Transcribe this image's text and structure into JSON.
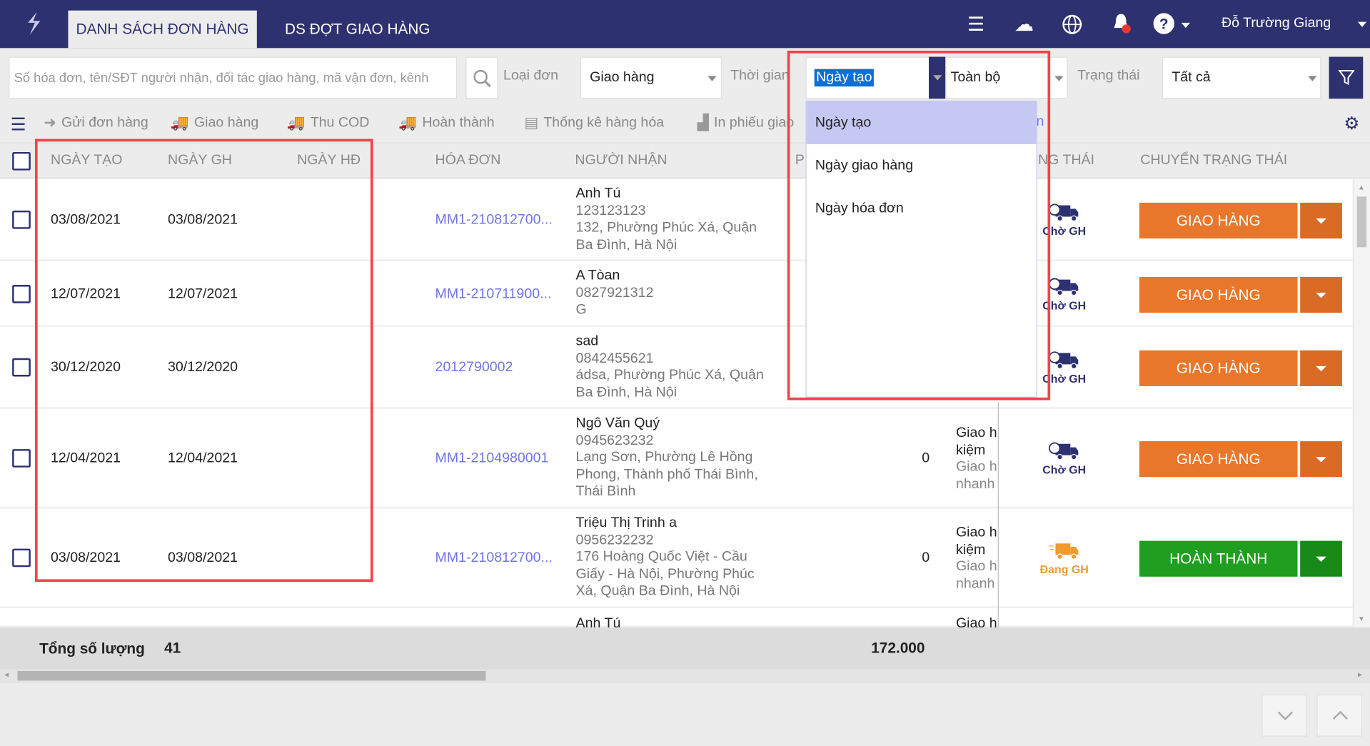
{
  "header": {
    "tabs": [
      {
        "label": "DANH SÁCH ĐƠN HÀNG",
        "active": true
      },
      {
        "label": "DS ĐỢT GIAO HÀNG",
        "active": false
      }
    ],
    "icons": [
      "menu-icon",
      "cloud-sync-icon",
      "globe-icon",
      "bell-icon",
      "help-icon"
    ],
    "user_name": "Đỗ Trường Giang"
  },
  "filters": {
    "search_placeholder": "Số hóa đơn, tên/SĐT người nhận, đối tác giao hàng, mã vận đơn, kênh",
    "order_type_label": "Loại đơn",
    "order_type_value": "Giao hàng",
    "time_label": "Thời gian",
    "time_field_value": "Ngày tạo",
    "time_range_value": "Toàn bộ",
    "status_label": "Trạng thái",
    "status_value": "Tất cả"
  },
  "time_dropdown": {
    "options": [
      "Ngày tạo",
      "Ngày giao hàng",
      "Ngày hóa đơn"
    ],
    "selected_index": 0
  },
  "toolbar": {
    "items": [
      "Gửi đơn hàng",
      "Giao hàng",
      "Thu COD",
      "Hoàn thành",
      "Thống kê hàng hóa",
      "In phiếu giao",
      "n"
    ]
  },
  "table": {
    "columns": [
      "NGÀY TẠO",
      "NGÀY GH",
      "NGÀY HĐ",
      "HÓA ĐƠN",
      "NGƯỜI NHẬN",
      "P",
      "NG THÁI",
      "CHUYỂN TRẠNG THÁI"
    ],
    "rows": [
      {
        "created": "03/08/2021",
        "delivery": "03/08/2021",
        "invoice_date": "",
        "invoice": "MM1-210812700...",
        "name": "Anh Tú",
        "phone": "123123123",
        "address": "132, Phường Phúc Xá, Quận Ba Đình, Hà Nội",
        "amount": "",
        "service": [],
        "status": "Chờ GH",
        "action": "GIAO HÀNG"
      },
      {
        "created": "12/07/2021",
        "delivery": "12/07/2021",
        "invoice_date": "",
        "invoice": "MM1-210711900...",
        "name": "A Tòan",
        "phone": "0827921312",
        "address": "G",
        "amount": "",
        "service": [],
        "status": "Chờ GH",
        "action": "GIAO HÀNG"
      },
      {
        "created": "30/12/2020",
        "delivery": "30/12/2020",
        "invoice_date": "",
        "invoice": "2012790002",
        "name": "sad",
        "phone": "0842455621",
        "address": "ádsa, Phường Phúc Xá, Quận Ba Đình, Hà Nội",
        "amount": "",
        "service": [],
        "status": "Chờ GH",
        "action": "GIAO HÀNG"
      },
      {
        "created": "12/04/2021",
        "delivery": "12/04/2021",
        "invoice_date": "",
        "invoice": "MM1-2104980001",
        "name": "Ngô Văn Quý",
        "phone": "0945623232",
        "address": "Lạng Sơn, Phường Lê Hồng Phong, Thành phố Thái Bình, Thái Bình",
        "amount": "0",
        "service": [
          "Giao h",
          "kiệm",
          "Giao h",
          "nhanh"
        ],
        "status": "Chờ GH",
        "action": "GIAO HÀNG"
      },
      {
        "created": "03/08/2021",
        "delivery": "03/08/2021",
        "invoice_date": "",
        "invoice": "MM1-210812700...",
        "name": "Triệu Thị Trinh a",
        "phone": "0956232232",
        "address": "176 Hoàng Quốc Việt - Cầu Giấy - Hà Nội, Phường Phúc Xá, Quận Ba Đình, Hà Nội",
        "amount": "0",
        "service": [
          "Giao h",
          "kiệm",
          "Giao h",
          "nhanh"
        ],
        "status": "Đang GH",
        "action": "HOÀN THÀNH"
      },
      {
        "name": "Anh Tú",
        "service": [
          "Giao h"
        ]
      }
    ]
  },
  "footer": {
    "total_label": "Tổng số lượng",
    "total_count": "41",
    "total_amount": "172.000"
  },
  "colors": {
    "brand": "#2d3170",
    "orange_action": "#e8772b",
    "green_action": "#1f9e1f",
    "link": "#6f75e6",
    "highlight": "#c5c8f2",
    "annotation": "#f2434a",
    "status_waiting": "#2d3170",
    "status_delivering": "#f29a2e"
  }
}
